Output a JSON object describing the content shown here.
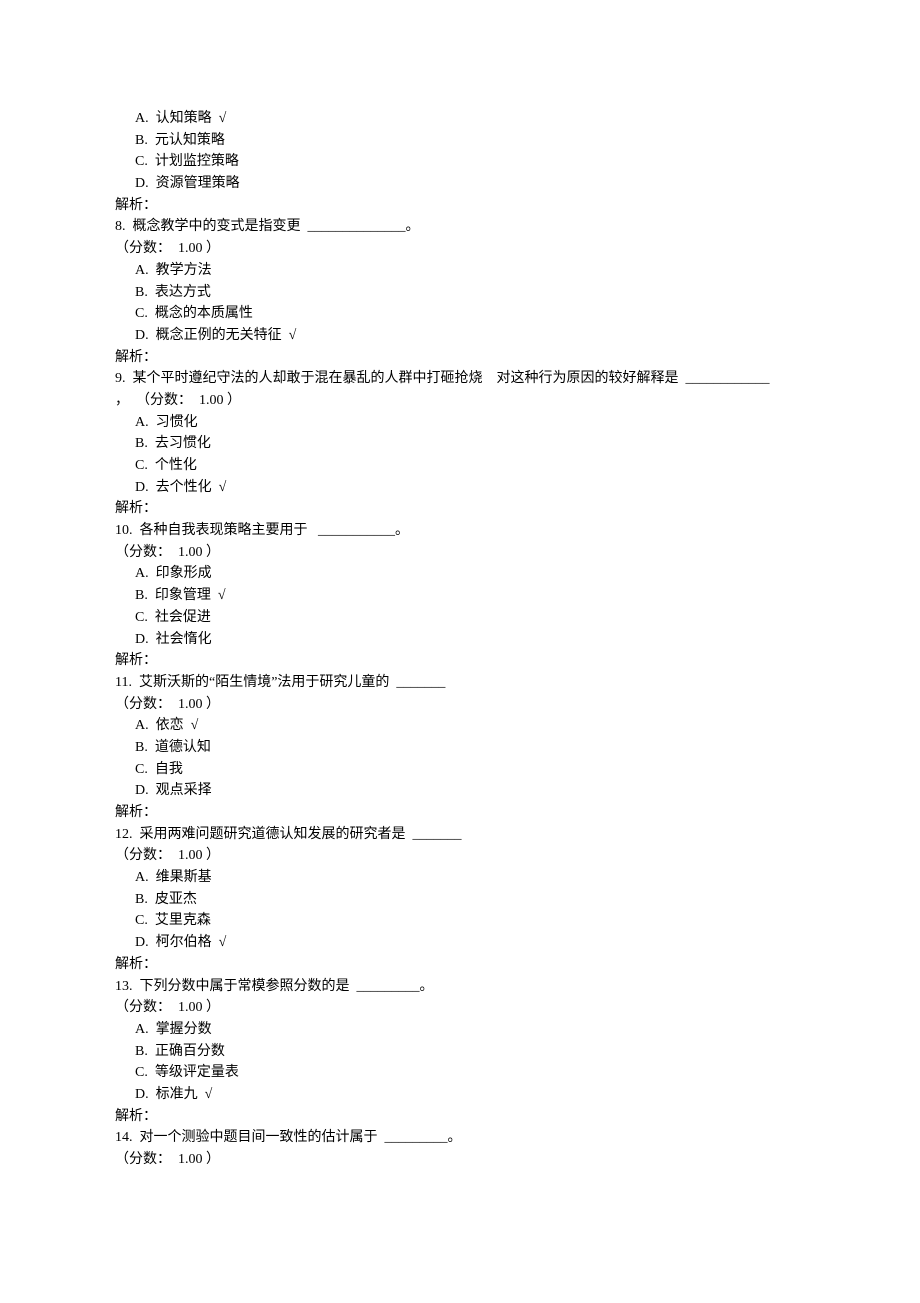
{
  "questions": [
    {
      "stem_prefix": "",
      "stem": "",
      "opts": [
        "A.  认知策略  √",
        "B.  元认知策略",
        "C.  计划监控策略",
        "D.  资源管理策略"
      ],
      "analysis": "解析："
    },
    {
      "stem": "8.  概念教学中的变式是指变更  ______________。",
      "score": "（分数：  1.00 ）",
      "opts": [
        "A.  教学方法",
        "B.  表达方式",
        "C.  概念的本质属性",
        "D.  概念正例的无关特征  √"
      ],
      "analysis": "解析："
    },
    {
      "stem": "9.  某个平时遵纪守法的人却敢于混在暴乱的人群中打砸抢烧    对这种行为原因的较好解释是  ____________",
      "stem2": "，  （分数：  1.00 ）",
      "opts": [
        "A.  习惯化",
        "B.  去习惯化",
        "C.  个性化",
        "D.  去个性化  √"
      ],
      "analysis": "解析："
    },
    {
      "stem": "10.  各种自我表现策略主要用于   ___________。",
      "score": "（分数：  1.00 ）",
      "opts": [
        "A.  印象形成",
        "B.  印象管理  √",
        "C.  社会促进",
        "D.  社会惰化"
      ],
      "analysis": "解析："
    },
    {
      "stem": "11.  艾斯沃斯的“陌生情境”法用于研究儿童的  _______",
      "score": "（分数：  1.00 ）",
      "opts": [
        "A.  依恋  √",
        "B.  道德认知",
        "C.  自我",
        "D.  观点采择"
      ],
      "analysis": "解析："
    },
    {
      "stem": "12.  采用两难问题研究道德认知发展的研究者是  _______",
      "score": "（分数：  1.00 ）",
      "opts": [
        "A.  维果斯基",
        "B.  皮亚杰",
        "C.  艾里克森",
        "D.  柯尔伯格  √"
      ],
      "analysis": "解析："
    },
    {
      "stem": "13.  下列分数中属于常模参照分数的是  _________。",
      "score": "（分数：  1.00 ）",
      "opts": [
        "A.  掌握分数",
        "B.  正确百分数",
        "C.  等级评定量表",
        "D.  标准九  √"
      ],
      "analysis": "解析："
    },
    {
      "stem": "14.  对一个测验中题目间一致性的估计属于  _________。",
      "score": "（分数：  1.00 ）",
      "opts": [],
      "analysis": ""
    }
  ]
}
